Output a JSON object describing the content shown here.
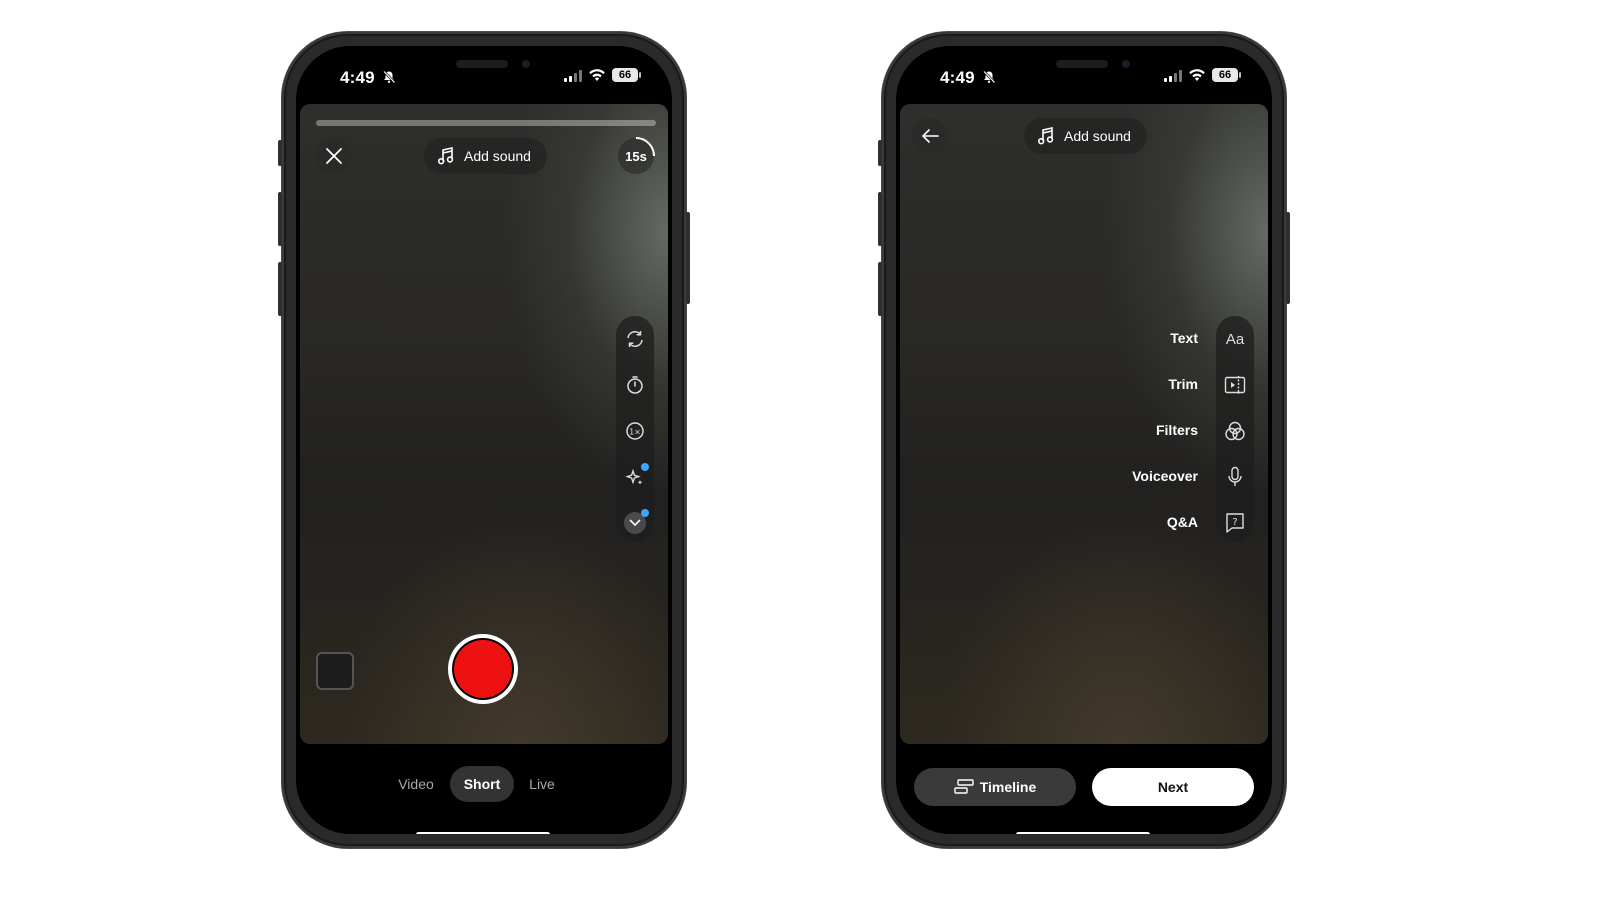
{
  "camera_screen": {
    "status": {
      "time": "4:49",
      "battery": "66"
    },
    "close_label": "×",
    "add_sound_label": "Add sound",
    "duration_label": "15s",
    "tools": [
      "flip-camera",
      "timer",
      "speed",
      "effects",
      "more"
    ],
    "modes": [
      "Video",
      "Short",
      "Live"
    ],
    "active_mode": "Short"
  },
  "edit_screen": {
    "status": {
      "time": "4:49",
      "battery": "66"
    },
    "add_sound_label": "Add sound",
    "tools": [
      {
        "label": "Text",
        "icon": "text-aa-icon",
        "glyph": "Aa"
      },
      {
        "label": "Trim",
        "icon": "trim-icon"
      },
      {
        "label": "Filters",
        "icon": "filters-icon"
      },
      {
        "label": "Voiceover",
        "icon": "microphone-icon"
      },
      {
        "label": "Q&A",
        "icon": "qa-icon"
      }
    ],
    "timeline_label": "Timeline",
    "next_label": "Next"
  },
  "colors": {
    "record": "#ee1111",
    "accent_dot": "#3ea6ff"
  }
}
